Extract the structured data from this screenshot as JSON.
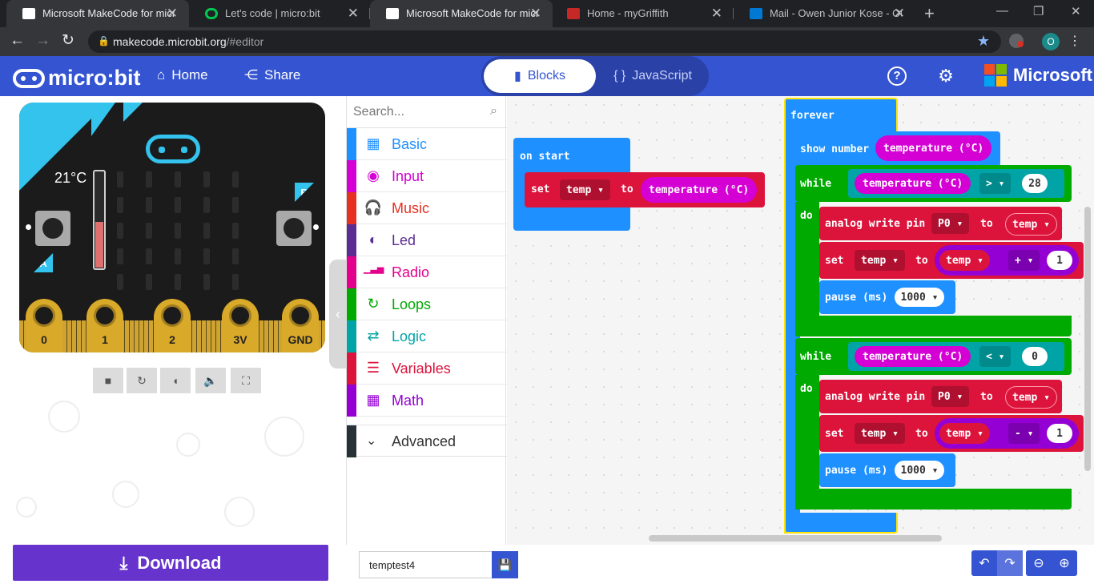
{
  "browser": {
    "tabs": [
      {
        "title": "Microsoft MakeCode for micro",
        "favicon_color": "#ffffff"
      },
      {
        "title": "Let's code | micro:bit",
        "favicon_color": "#00c853"
      },
      {
        "title": "Microsoft MakeCode for micro",
        "favicon_color": "#ffffff"
      },
      {
        "title": "Home - myGriffith",
        "favicon_color": "#c62828"
      },
      {
        "title": "Mail - Owen Junior Kose - Out",
        "favicon_color": "#0078d4"
      }
    ],
    "new_tab": "+",
    "url_host": "makecode.microbit.org",
    "url_path": "/#editor",
    "profile_initial": "O"
  },
  "header": {
    "logo_text": "micro:bit",
    "home_label": "Home",
    "share_label": "Share",
    "blocks_label": "Blocks",
    "javascript_label": "JavaScript",
    "microsoft_label": "Microsoft"
  },
  "simulator": {
    "temperature_text": "21°C",
    "button_a": "A",
    "button_b": "B",
    "pins": [
      "0",
      "1",
      "2",
      "3V",
      "GND"
    ],
    "temperature_level": 0.47
  },
  "toolbox": {
    "search_placeholder": "Search...",
    "categories": [
      {
        "name": "Basic",
        "color": "#1e90ff",
        "icon": "grid-icon"
      },
      {
        "name": "Input",
        "color": "#d400d4",
        "icon": "target-icon"
      },
      {
        "name": "Music",
        "color": "#e63022",
        "icon": "headphones-icon"
      },
      {
        "name": "Led",
        "color": "#5c2d91",
        "icon": "toggle-icon"
      },
      {
        "name": "Radio",
        "color": "#e3008c",
        "icon": "signal-icon"
      },
      {
        "name": "Loops",
        "color": "#00aa00",
        "icon": "refresh-icon"
      },
      {
        "name": "Logic",
        "color": "#00a4a6",
        "icon": "shuffle-icon"
      },
      {
        "name": "Variables",
        "color": "#dc143c",
        "icon": "list-icon"
      },
      {
        "name": "Math",
        "color": "#9400d3",
        "icon": "calculator-icon"
      }
    ],
    "advanced_label": "Advanced"
  },
  "workspace": {
    "on_start": {
      "label": "on start",
      "set": "set",
      "var": "temp",
      "to": "to",
      "value": "temperature (°C)"
    },
    "forever": {
      "label": "forever",
      "show_number": "show number",
      "show_value": "temperature (°C)",
      "loops": [
        {
          "while": "while",
          "cond_left": "temperature (°C)",
          "op": ">",
          "cond_right": "28",
          "do": "do",
          "analog": "analog write pin",
          "pin": "P0",
          "to": "to",
          "var": "temp",
          "set": "set",
          "set_var": "temp",
          "math_var": "temp",
          "math_op": "+",
          "math_num": "1",
          "pause": "pause (ms)",
          "pause_val": "1000"
        },
        {
          "while": "while",
          "cond_left": "temperature (°C)",
          "op": "<",
          "cond_right": "0",
          "do": "do",
          "analog": "analog write pin",
          "pin": "P0",
          "to": "to",
          "var": "temp",
          "set": "set",
          "set_var": "temp",
          "math_var": "temp",
          "math_op": "-",
          "math_num": "1",
          "pause": "pause (ms)",
          "pause_val": "1000"
        }
      ]
    }
  },
  "bottom": {
    "download_label": "Download",
    "project_name": "temptest4"
  },
  "colors": {
    "header": "#3454d1",
    "basic": "#1e90ff",
    "loops": "#00aa00",
    "logic": "#00a4a6",
    "variables": "#dc143c",
    "input": "#d400d4",
    "math": "#9400d3",
    "download": "#6633cc"
  }
}
